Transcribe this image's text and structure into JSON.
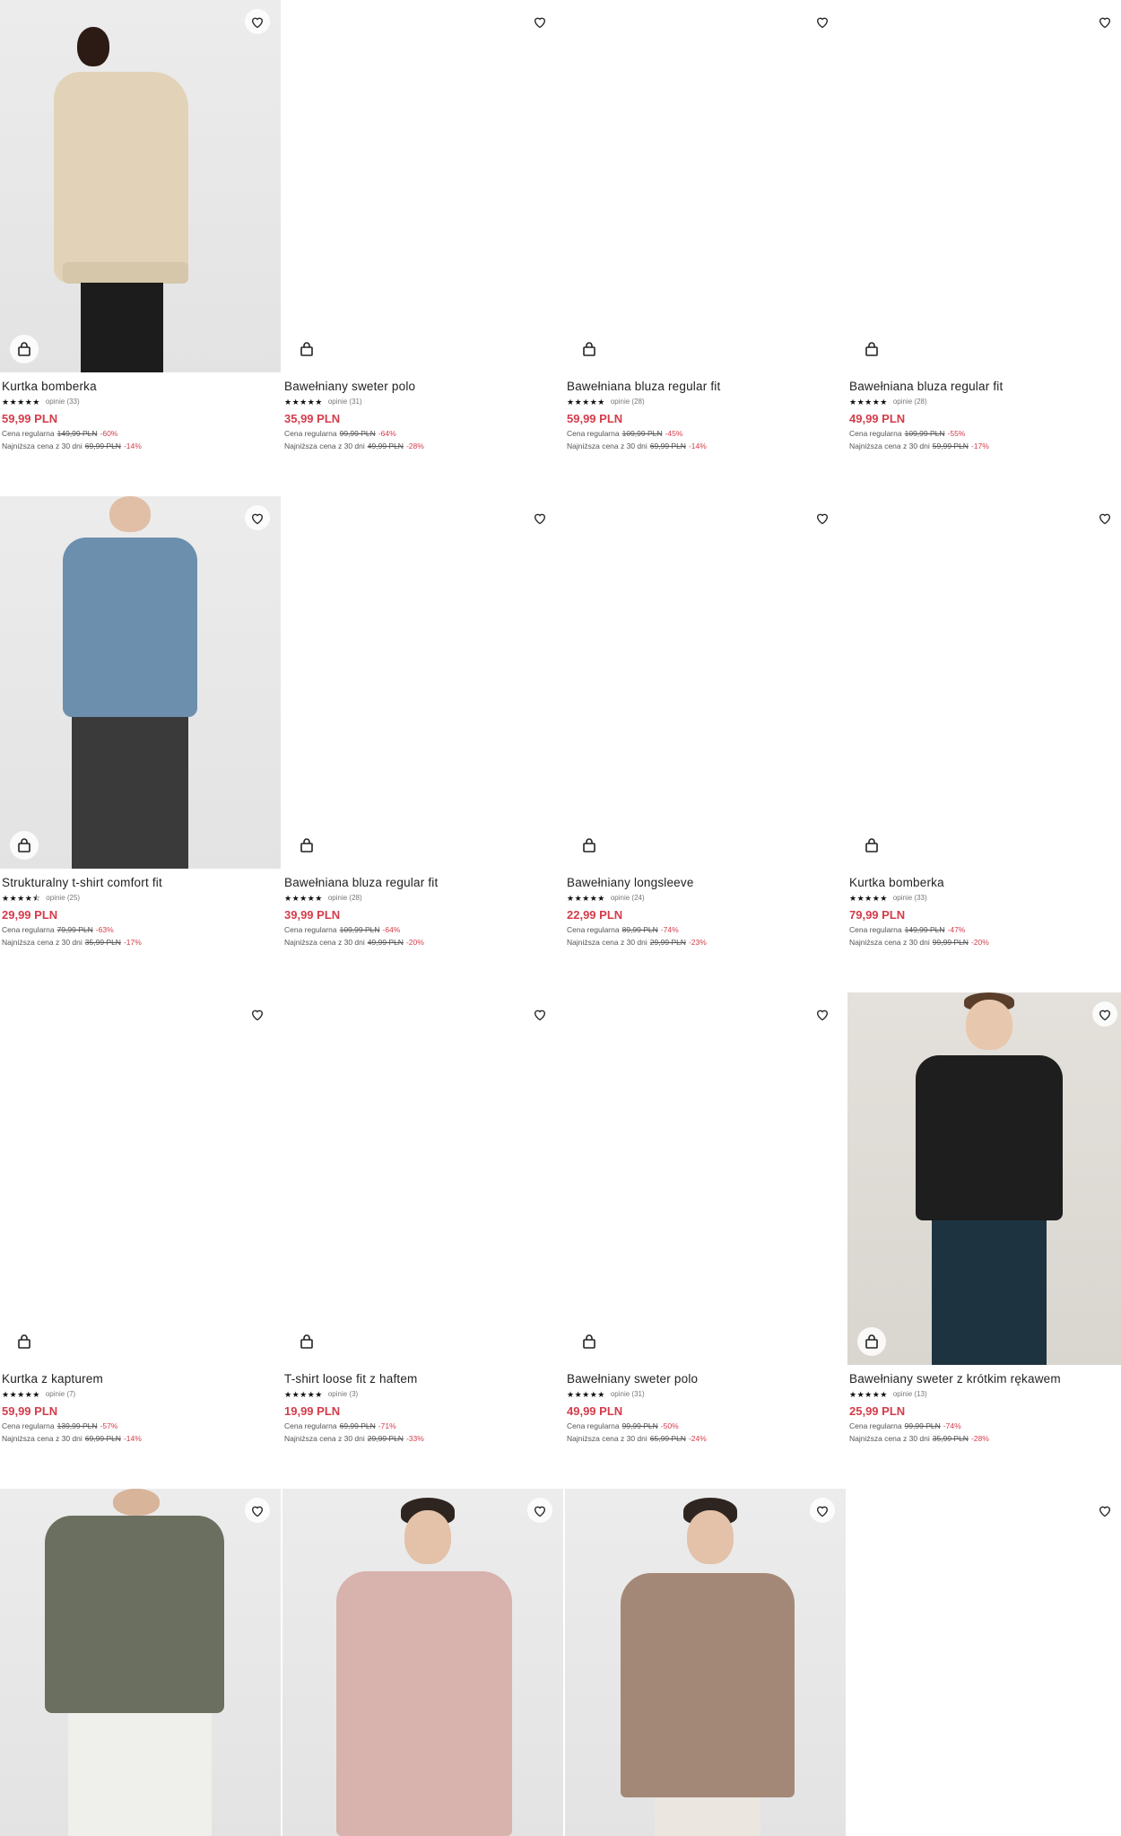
{
  "ui": {
    "favorite_icon": "heart-outline-icon",
    "cart_icon": "shopping-bag-icon",
    "accent_color": "#d43c4a"
  },
  "products": [
    {
      "name": "Kurtka bomberka",
      "stars": "★★★★★",
      "reviews": "opinie (33)",
      "price": "59,99 PLN",
      "regular_label": "Cena regularna",
      "regular_price": "149,99 PLN",
      "regular_discount": "-60%",
      "lowest_label": "Najniższa cena z 30 dni",
      "lowest_price": "69,99 PLN",
      "lowest_discount": "-14%"
    },
    {
      "name": "Bawełniany sweter polo",
      "stars": "★★★★★",
      "reviews": "opinie (31)",
      "price": "35,99 PLN",
      "regular_label": "Cena regularna",
      "regular_price": "99,99 PLN",
      "regular_discount": "-64%",
      "lowest_label": "Najniższa cena z 30 dni",
      "lowest_price": "49,99 PLN",
      "lowest_discount": "-28%"
    },
    {
      "name": "Bawełniana bluza regular fit",
      "stars": "★★★★★",
      "reviews": "opinie (28)",
      "price": "59,99 PLN",
      "regular_label": "Cena regularna",
      "regular_price": "109,99 PLN",
      "regular_discount": "-45%",
      "lowest_label": "Najniższa cena z 30 dni",
      "lowest_price": "69,99 PLN",
      "lowest_discount": "-14%"
    },
    {
      "name": "Bawełniana bluza regular fit",
      "stars": "★★★★★",
      "reviews": "opinie (28)",
      "price": "49,99 PLN",
      "regular_label": "Cena regularna",
      "regular_price": "109,99 PLN",
      "regular_discount": "-55%",
      "lowest_label": "Najniższa cena z 30 dni",
      "lowest_price": "59,99 PLN",
      "lowest_discount": "-17%"
    },
    {
      "name": "Strukturalny t-shirt comfort fit",
      "stars": "★★★★⯪",
      "reviews": "opinie (25)",
      "price": "29,99 PLN",
      "regular_label": "Cena regularna",
      "regular_price": "79,99 PLN",
      "regular_discount": "-63%",
      "lowest_label": "Najniższa cena z 30 dni",
      "lowest_price": "35,99 PLN",
      "lowest_discount": "-17%"
    },
    {
      "name": "Bawełniana bluza regular fit",
      "stars": "★★★★★",
      "reviews": "opinie (28)",
      "price": "39,99 PLN",
      "regular_label": "Cena regularna",
      "regular_price": "109,99 PLN",
      "regular_discount": "-64%",
      "lowest_label": "Najniższa cena z 30 dni",
      "lowest_price": "49,99 PLN",
      "lowest_discount": "-20%"
    },
    {
      "name": "Bawełniany longsleeve",
      "stars": "★★★★★",
      "reviews": "opinie (24)",
      "price": "22,99 PLN",
      "regular_label": "Cena regularna",
      "regular_price": "89,99 PLN",
      "regular_discount": "-74%",
      "lowest_label": "Najniższa cena z 30 dni",
      "lowest_price": "29,99 PLN",
      "lowest_discount": "-23%"
    },
    {
      "name": "Kurtka bomberka",
      "stars": "★★★★★",
      "reviews": "opinie (33)",
      "price": "79,99 PLN",
      "regular_label": "Cena regularna",
      "regular_price": "149,99 PLN",
      "regular_discount": "-47%",
      "lowest_label": "Najniższa cena z 30 dni",
      "lowest_price": "99,99 PLN",
      "lowest_discount": "-20%"
    },
    {
      "name": "Kurtka z kapturem",
      "stars": "★★★★★",
      "reviews": "opinie (7)",
      "price": "59,99 PLN",
      "regular_label": "Cena regularna",
      "regular_price": "139,99 PLN",
      "regular_discount": "-57%",
      "lowest_label": "Najniższa cena z 30 dni",
      "lowest_price": "69,99 PLN",
      "lowest_discount": "-14%"
    },
    {
      "name": "T-shirt loose fit z haftem",
      "stars": "★★★★★",
      "reviews": "opinie (3)",
      "price": "19,99 PLN",
      "regular_label": "Cena regularna",
      "regular_price": "69,99 PLN",
      "regular_discount": "-71%",
      "lowest_label": "Najniższa cena z 30 dni",
      "lowest_price": "29,99 PLN",
      "lowest_discount": "-33%"
    },
    {
      "name": "Bawełniany sweter polo",
      "stars": "★★★★★",
      "reviews": "opinie (31)",
      "price": "49,99 PLN",
      "regular_label": "Cena regularna",
      "regular_price": "99,99 PLN",
      "regular_discount": "-50%",
      "lowest_label": "Najniższa cena z 30 dni",
      "lowest_price": "65,99 PLN",
      "lowest_discount": "-24%"
    },
    {
      "name": "Bawełniany sweter z krótkim rękawem",
      "stars": "★★★★★",
      "reviews": "opinie (13)",
      "price": "25,99 PLN",
      "regular_label": "Cena regularna",
      "regular_price": "99,99 PLN",
      "regular_discount": "-74%",
      "lowest_label": "Najniższa cena z 30 dni",
      "lowest_price": "35,99 PLN",
      "lowest_discount": "-28%"
    }
  ]
}
